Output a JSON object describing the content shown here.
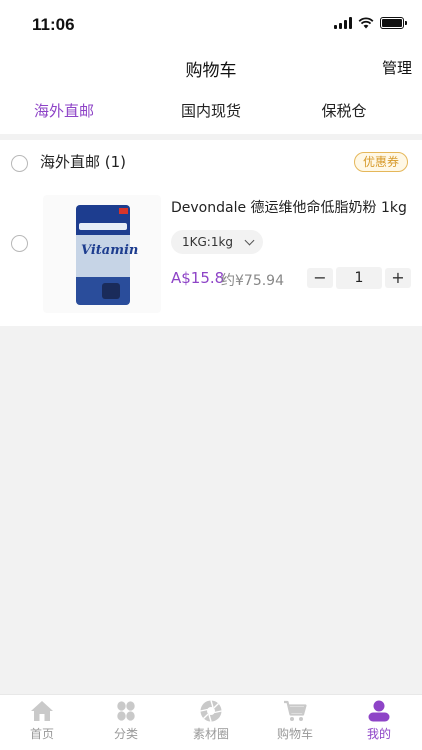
{
  "status_bar": {
    "time": "11:06"
  },
  "nav": {
    "title": "购物车",
    "action": "管理"
  },
  "tabs": [
    {
      "label": "海外直邮",
      "active": true
    },
    {
      "label": "国内现货",
      "active": false
    },
    {
      "label": "保税仓",
      "active": false
    }
  ],
  "cart_group": {
    "title": "海外直邮 (1)",
    "coupon_label": "优惠券",
    "item": {
      "name": "Devondale 德运维他命低脂奶粉 1kg",
      "spec": "1KG:1kg",
      "price_aud": "A$15.8",
      "price_cny": "约¥75.94",
      "quantity": "1",
      "decrement_symbol": "−",
      "increment_symbol": "+"
    }
  },
  "bottom_tabs": [
    {
      "label": "首页",
      "icon": "home-icon",
      "active": false
    },
    {
      "label": "分类",
      "icon": "category-icon",
      "active": false
    },
    {
      "label": "素材圈",
      "icon": "aperture-icon",
      "active": false
    },
    {
      "label": "购物车",
      "icon": "cart-icon",
      "active": false
    },
    {
      "label": "我的",
      "icon": "profile-icon",
      "active": true
    }
  ],
  "colors": {
    "accent": "#8e44c7",
    "coupon": "#d79a2b",
    "inactive": "#999999"
  }
}
